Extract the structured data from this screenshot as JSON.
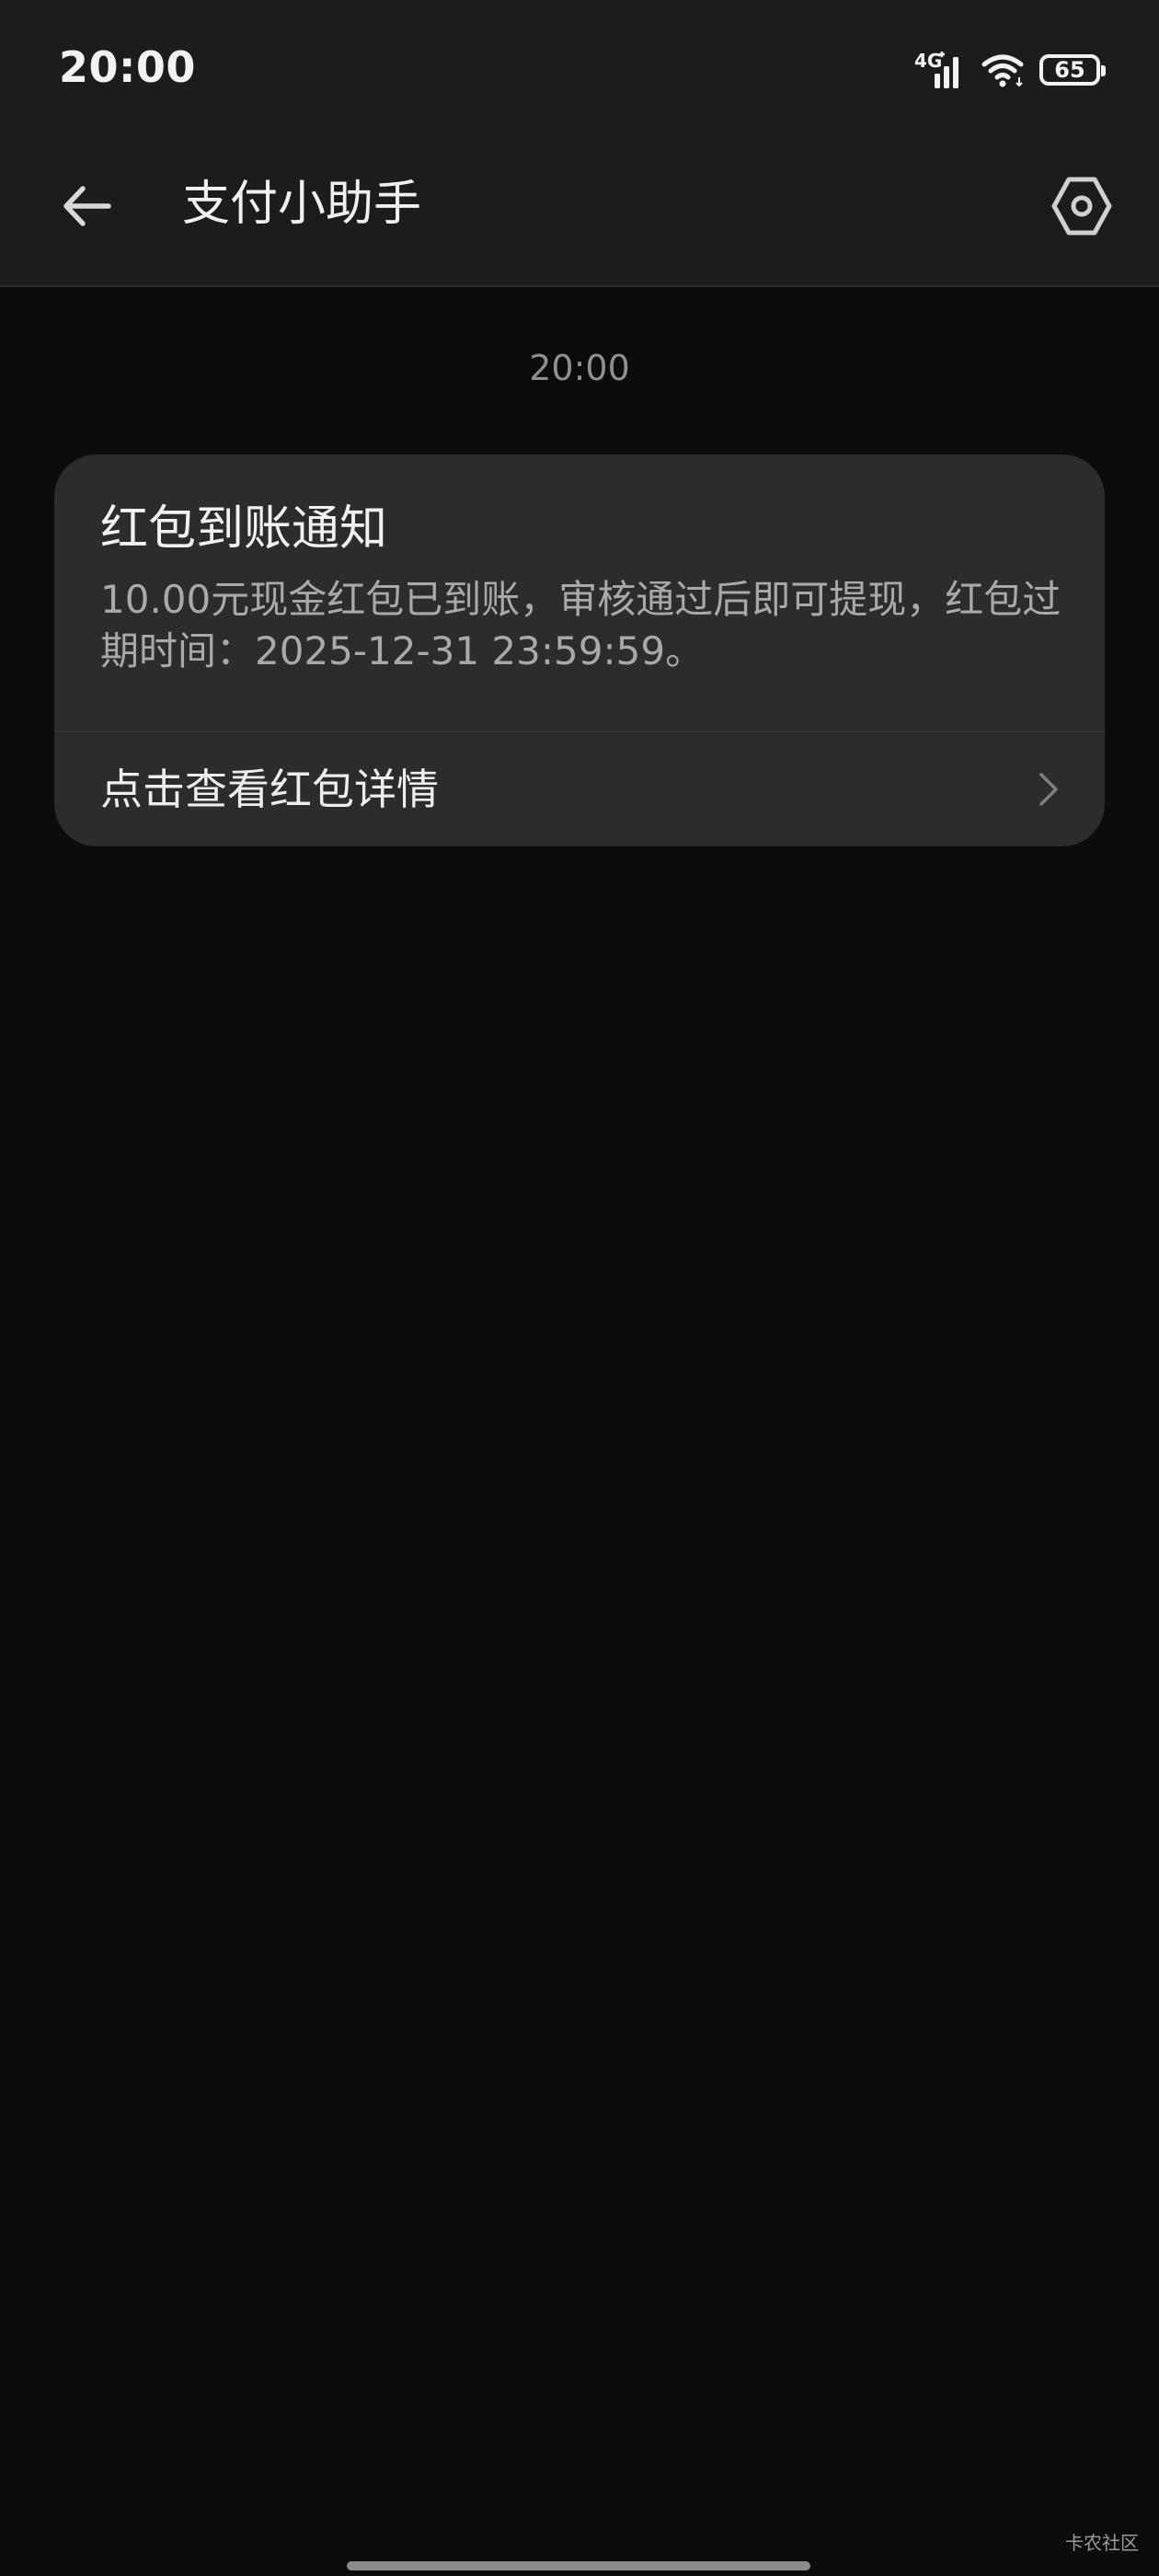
{
  "status_bar": {
    "time": "20:00",
    "network_type": "4G",
    "battery_level": "65",
    "icons": [
      "signal-icon",
      "wifi-icon",
      "battery-icon"
    ]
  },
  "app_bar": {
    "title": "支付小助手",
    "back_icon": "back-arrow-icon",
    "settings_icon": "settings-hexagon-icon"
  },
  "conversation": {
    "timestamp": "20:00",
    "messages": [
      {
        "title": "红包到账通知",
        "body": "10.00元现金红包已到账，审核通过后即可提现，红包过期时间：2025-12-31 23:59:59。",
        "action_label": "点击查看红包详情",
        "action_icon": "chevron-right-icon"
      }
    ]
  },
  "watermark": "卡农社区",
  "colors": {
    "background": "#0b0c0e",
    "surface": "#1b1c1e",
    "card": "#2b2c2e",
    "secondary_text": "#a8a9ad"
  }
}
